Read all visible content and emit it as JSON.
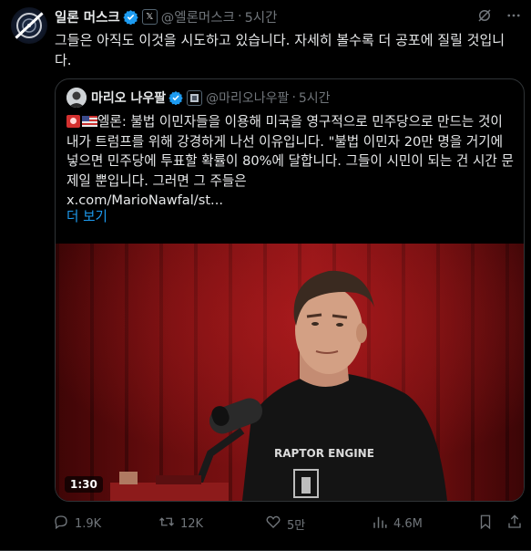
{
  "post": {
    "author_name": "일론 머스크",
    "affiliate_badge": "𝕏",
    "handle": "@엘론머스크",
    "dot": "·",
    "time": "5시간",
    "text": "그들은 아직도 이것을 시도하고 있습니다. 자세히 볼수록 더 공포에 질릴 것입니다."
  },
  "quote": {
    "author_name": "마리오 나우팔",
    "handle": "@마리오나우팔",
    "dot": "·",
    "time": "5시간",
    "text": "엘론: 불법 이민자들을 이용해 미국을 영구적으로 민주당으로 만드는 것이 내가 트럼프를 위해 강경하게 나선 이유입니다. \"불법 이민자 20만 명을 거기에 넣으면 민주당에 투표할 확률이 80%에 달합니다. 그들이 시민이 되는 건 시간 문제일 뿐입니다. 그러면 그 주들은",
    "link": "x.com/MarioNawfal/st...",
    "show_more": "더 보기",
    "video": {
      "timestamp": "1:30",
      "shirt_text": "RAPTOR ENGINE"
    }
  },
  "actions": {
    "replies": "1.9K",
    "reposts": "12K",
    "likes": "5만",
    "views": "4.6M"
  },
  "colors": {
    "background": "#000000",
    "text": "#e7e9ea",
    "muted": "#71767b",
    "accent": "#1d9bf0",
    "border": "#2f3336"
  },
  "icons": [
    "verified-badge-icon",
    "grok-icon",
    "more-icon",
    "reply-icon",
    "repost-icon",
    "like-icon",
    "views-icon",
    "bookmark-icon",
    "share-icon"
  ]
}
